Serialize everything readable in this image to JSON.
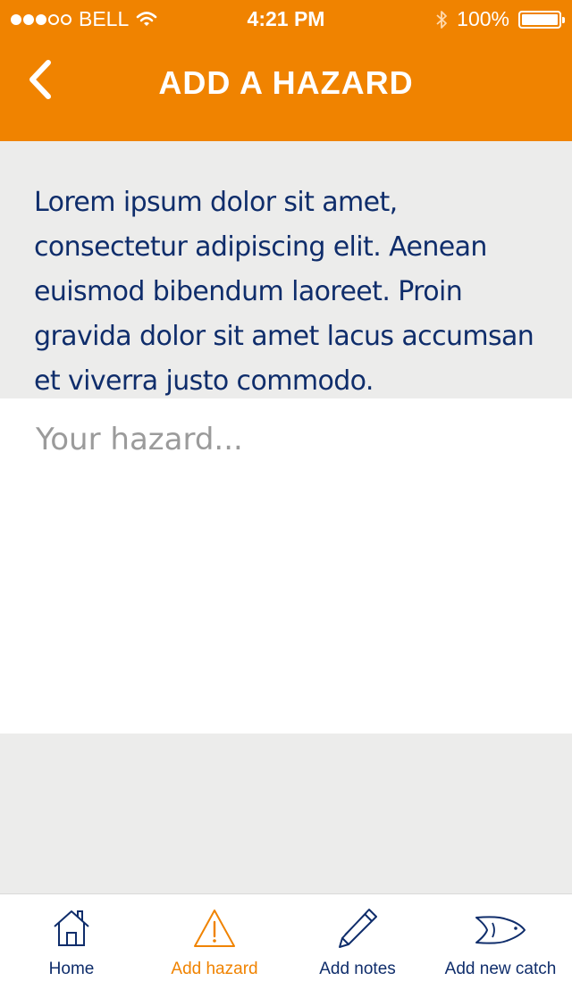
{
  "status_bar": {
    "carrier": "BELL",
    "time": "4:21 PM",
    "battery": "100%",
    "battery_level": 1.0,
    "signal_bars_filled": 3,
    "signal_bars_total": 5
  },
  "nav": {
    "title": "ADD A HAZARD",
    "back_icon": "chevron-left-icon"
  },
  "intro": {
    "text": "Lorem ipsum dolor sit amet, consectetur adipiscing elit. Aenean euismod bibendum laoreet. Proin gravida dolor sit amet lacus accumsan et viverra justo commodo."
  },
  "hazard_input": {
    "value": "",
    "placeholder": "Your hazard..."
  },
  "tab_bar": {
    "tabs": [
      {
        "label": "Home",
        "icon": "home-icon",
        "active": false
      },
      {
        "label": "Add hazard",
        "icon": "warning-icon",
        "active": true
      },
      {
        "label": "Add notes",
        "icon": "pencil-icon",
        "active": false
      },
      {
        "label": "Add new catch",
        "icon": "fish-icon",
        "active": false
      }
    ]
  },
  "colors": {
    "brand_orange": "#f08300",
    "text_navy": "#0f2d6b",
    "background_gray": "#ececeb",
    "placeholder_gray": "#9b9b9b"
  }
}
